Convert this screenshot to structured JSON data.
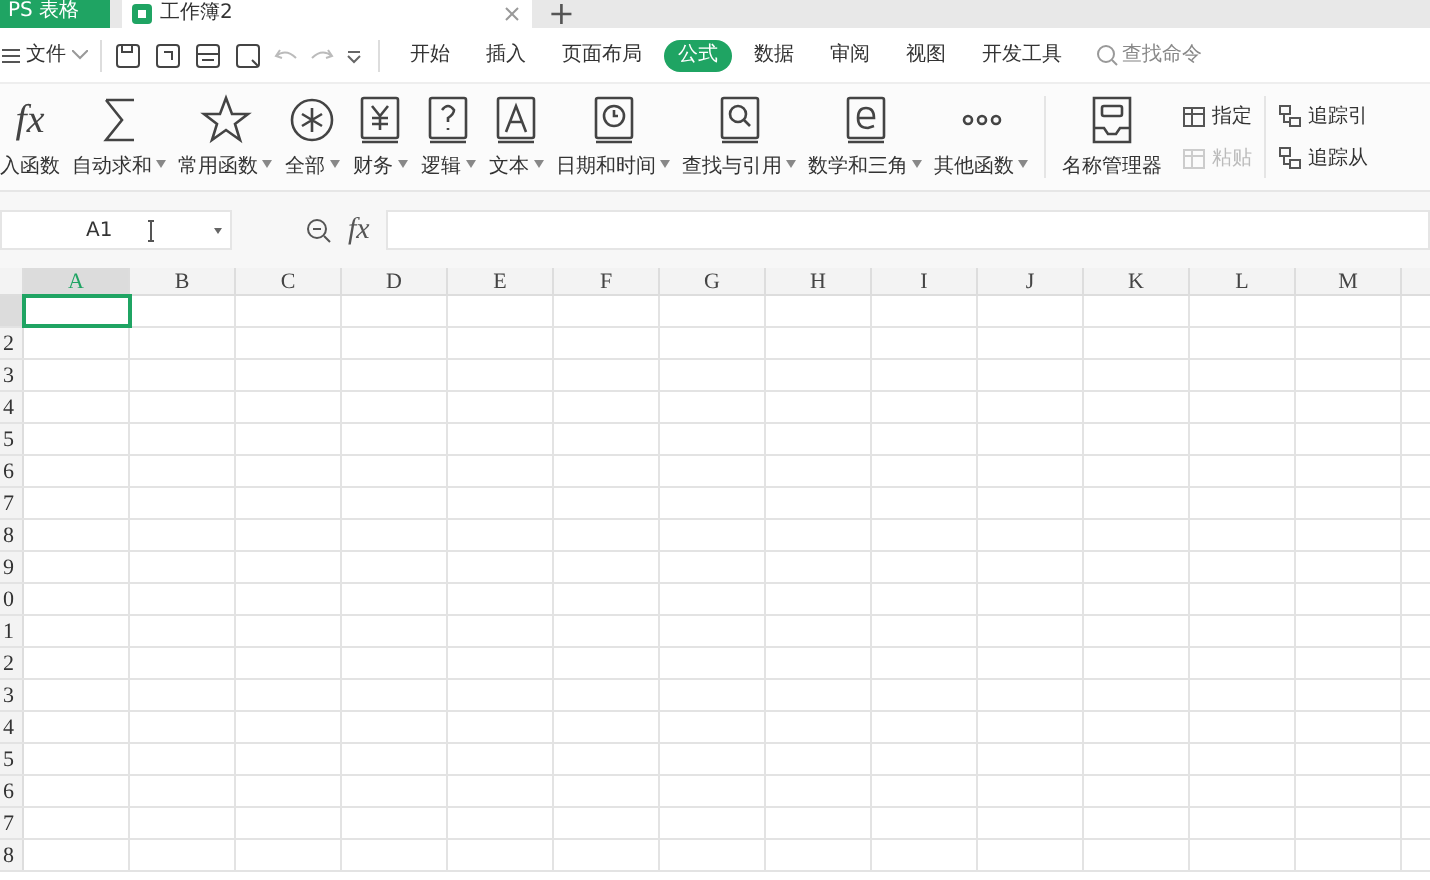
{
  "title_bar": {
    "app_tab": "PS 表格",
    "tabs": [
      {
        "label": "工作簿2",
        "selected": true
      }
    ],
    "new_tab": "+"
  },
  "menu_bar": {
    "file_menu": "文件",
    "tabs": [
      {
        "label": "开始",
        "selected": false
      },
      {
        "label": "插入",
        "selected": false
      },
      {
        "label": "页面布局",
        "selected": false
      },
      {
        "label": "公式",
        "selected": true
      },
      {
        "label": "数据",
        "selected": false
      },
      {
        "label": "审阅",
        "selected": false
      },
      {
        "label": "视图",
        "selected": false
      },
      {
        "label": "开发工具",
        "selected": false
      }
    ],
    "search": {
      "placeholder": "查找命令"
    }
  },
  "ribbon": {
    "insert_icon_text": "fx",
    "functions": [
      {
        "label": "入函数",
        "has_menu": false
      },
      {
        "label": "自动求和",
        "has_menu": true
      },
      {
        "label": "常用函数",
        "has_menu": true
      },
      {
        "label": "全部",
        "has_menu": true
      },
      {
        "label": "财务",
        "has_menu": true
      },
      {
        "label": "逻辑",
        "has_menu": true
      },
      {
        "label": "文本",
        "has_menu": true
      },
      {
        "label": "日期和时间",
        "has_menu": true
      },
      {
        "label": "查找与引用",
        "has_menu": true
      },
      {
        "label": "数学和三角",
        "has_menu": true
      },
      {
        "label": "其他函数",
        "has_menu": true
      }
    ],
    "name_manager": "名称管理器",
    "small_buttons": [
      {
        "label": "指定",
        "disabled": false
      },
      {
        "label": "粘贴",
        "disabled": true
      }
    ],
    "trace_buttons": [
      {
        "label": "追踪引"
      },
      {
        "label": "追踪从"
      }
    ]
  },
  "formula_bar": {
    "name_box": "A1",
    "fx": "fx"
  },
  "sheet": {
    "columns": [
      {
        "label": "A",
        "selected": true
      },
      {
        "label": "B",
        "selected": false
      },
      {
        "label": "C",
        "selected": false
      },
      {
        "label": "D",
        "selected": false
      },
      {
        "label": "E",
        "selected": false
      },
      {
        "label": "F",
        "selected": false
      },
      {
        "label": "G",
        "selected": false
      },
      {
        "label": "H",
        "selected": false
      },
      {
        "label": "I",
        "selected": false
      },
      {
        "label": "J",
        "selected": false
      },
      {
        "label": "K",
        "selected": false
      },
      {
        "label": "L",
        "selected": false
      },
      {
        "label": "M",
        "selected": false
      }
    ],
    "rows": [
      {
        "selected": true
      },
      {
        "label": "2",
        "selected": false
      },
      {
        "label": "3",
        "selected": false
      },
      {
        "label": "4",
        "selected": false
      },
      {
        "label": "5",
        "selected": false
      },
      {
        "label": "6",
        "selected": false
      },
      {
        "label": "7",
        "selected": false
      },
      {
        "label": "8",
        "selected": false
      },
      {
        "label": "9",
        "selected": false
      },
      {
        "label": "0",
        "selected": false
      },
      {
        "label": "1",
        "selected": false
      },
      {
        "label": "2",
        "selected": false
      },
      {
        "label": "3",
        "selected": false
      },
      {
        "label": "4",
        "selected": false
      },
      {
        "label": "5",
        "selected": false
      },
      {
        "label": "6",
        "selected": false
      },
      {
        "label": "7",
        "selected": false
      },
      {
        "label": "8",
        "selected": false
      }
    ]
  }
}
